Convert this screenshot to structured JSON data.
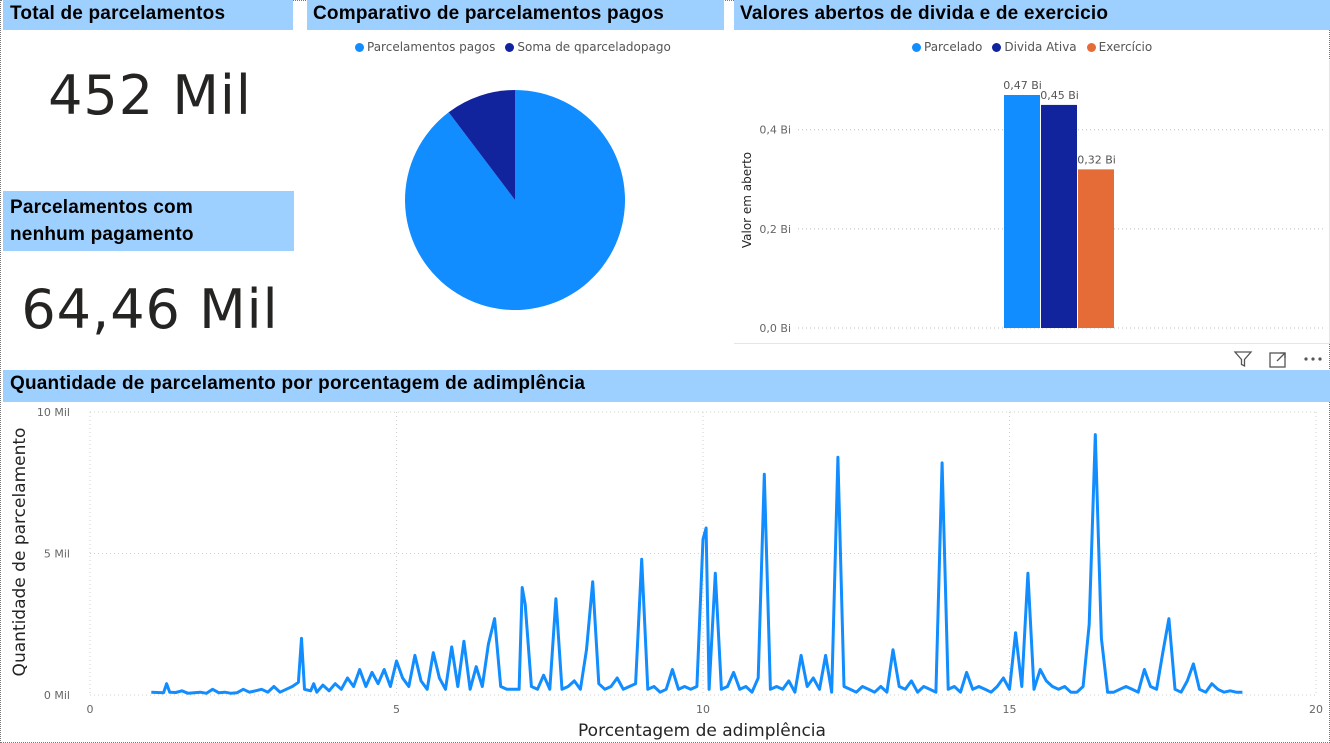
{
  "card_total": {
    "title": "Total de parcelamentos",
    "value": "452 Mil"
  },
  "card_sem_pagamento": {
    "title_line1": "Parcelamentos com",
    "title_line2": "nenhum pagamento",
    "value": "64,46 Mil"
  },
  "pie": {
    "title": "Comparativo de parcelamentos pagos",
    "legend": [
      {
        "label": "Parcelamentos pagos",
        "color": "#118dff"
      },
      {
        "label": "Soma de qparceladopago",
        "color": "#12239e"
      }
    ]
  },
  "bars": {
    "title": "Valores abertos de divida e de exercicio",
    "legend": [
      {
        "label": "Parcelado",
        "color": "#118dff"
      },
      {
        "label": "Divida Ativa",
        "color": "#12239e"
      },
      {
        "label": "Exercício",
        "color": "#e66c37"
      }
    ],
    "ylabel": "Valor em aberto",
    "ticks": [
      "0,0 Bi",
      "0,2 Bi",
      "0,4 Bi"
    ]
  },
  "line": {
    "title": "Quantidade de parcelamento por porcentagem de adimplência",
    "xlabel": "Porcentagem de adimplência",
    "ylabel": "Quantidade de parcelamento",
    "yticks": [
      "0 Mil",
      "5 Mil",
      "10 Mil"
    ],
    "xticks": [
      "0",
      "5",
      "10",
      "15",
      "20"
    ]
  },
  "chart_data": [
    {
      "type": "pie",
      "title": "Comparativo de parcelamentos pagos",
      "categories": [
        "Parcelamentos pagos",
        "Soma de qparceladopago"
      ],
      "values": [
        89.7,
        10.3
      ]
    },
    {
      "type": "bar",
      "title": "Valores abertos de divida e de exercicio",
      "categories": [
        "Parcelado",
        "Divida Ativa",
        "Exercício"
      ],
      "values": [
        0.47,
        0.45,
        0.32
      ],
      "data_labels": [
        "0,47 Bi",
        "0,45 Bi",
        "0,32 Bi"
      ],
      "ylabel": "Valor em aberto",
      "ylim": [
        0,
        0.47
      ],
      "grid": true,
      "legend": "top"
    },
    {
      "type": "line",
      "title": "Quantidade de parcelamento por porcentagem de adimplência",
      "xlabel": "Porcentagem de adimplência",
      "ylabel": "Quantidade de parcelamento",
      "xlim": [
        0,
        20
      ],
      "ylim": [
        0,
        10000
      ],
      "grid": true,
      "x": [
        1.0,
        1.2,
        1.25,
        1.3,
        1.4,
        1.5,
        1.6,
        1.7,
        1.8,
        1.9,
        2.0,
        2.1,
        2.2,
        2.3,
        2.4,
        2.5,
        2.6,
        2.7,
        2.8,
        2.9,
        3.0,
        3.1,
        3.2,
        3.3,
        3.4,
        3.45,
        3.5,
        3.6,
        3.65,
        3.7,
        3.8,
        3.9,
        4.0,
        4.1,
        4.2,
        4.3,
        4.4,
        4.5,
        4.6,
        4.7,
        4.8,
        4.9,
        5.0,
        5.1,
        5.2,
        5.3,
        5.4,
        5.5,
        5.6,
        5.7,
        5.8,
        5.9,
        6.0,
        6.1,
        6.2,
        6.3,
        6.4,
        6.5,
        6.6,
        6.7,
        6.8,
        6.9,
        7.0,
        7.05,
        7.1,
        7.2,
        7.3,
        7.4,
        7.5,
        7.6,
        7.7,
        7.8,
        7.9,
        8.0,
        8.1,
        8.2,
        8.3,
        8.4,
        8.5,
        8.6,
        8.7,
        8.8,
        8.9,
        9.0,
        9.1,
        9.2,
        9.3,
        9.4,
        9.5,
        9.6,
        9.7,
        9.8,
        9.9,
        10.0,
        10.05,
        10.1,
        10.2,
        10.3,
        10.4,
        10.5,
        10.6,
        10.7,
        10.8,
        10.9,
        11.0,
        11.1,
        11.2,
        11.3,
        11.4,
        11.5,
        11.6,
        11.7,
        11.8,
        11.9,
        12.0,
        12.1,
        12.2,
        12.3,
        12.4,
        12.5,
        12.6,
        12.7,
        12.8,
        12.9,
        13.0,
        13.1,
        13.2,
        13.3,
        13.4,
        13.5,
        13.6,
        13.7,
        13.8,
        13.9,
        14.0,
        14.1,
        14.2,
        14.3,
        14.4,
        14.5,
        14.6,
        14.7,
        14.8,
        14.9,
        15.0,
        15.1,
        15.2,
        15.3,
        15.4,
        15.5,
        15.6,
        15.7,
        15.8,
        15.9,
        16.0,
        16.1,
        16.2,
        16.3,
        16.4,
        16.5,
        16.6,
        16.7,
        16.8,
        16.9,
        17.0,
        17.1,
        17.2,
        17.3,
        17.4,
        17.5,
        17.6,
        17.7,
        17.8,
        17.9,
        18.0,
        18.1,
        18.2,
        18.3,
        18.4,
        18.5,
        18.6,
        18.7,
        18.8,
        18.9,
        19.0,
        19.1,
        19.2,
        19.3,
        19.4,
        19.5
      ],
      "y": [
        100,
        80,
        400,
        100,
        90,
        150,
        60,
        80,
        100,
        60,
        200,
        80,
        100,
        60,
        80,
        200,
        100,
        150,
        200,
        100,
        300,
        100,
        200,
        300,
        450,
        2000,
        200,
        150,
        400,
        100,
        350,
        150,
        400,
        200,
        600,
        300,
        900,
        300,
        800,
        400,
        900,
        300,
        1200,
        600,
        300,
        1400,
        500,
        200,
        1500,
        600,
        200,
        1700,
        300,
        1900,
        200,
        1000,
        300,
        1800,
        2700,
        300,
        200,
        200,
        200,
        3800,
        3200,
        300,
        200,
        700,
        200,
        3400,
        200,
        300,
        500,
        200,
        1600,
        4000,
        400,
        200,
        300,
        600,
        200,
        300,
        400,
        4800,
        200,
        300,
        100,
        200,
        900,
        200,
        300,
        200,
        300,
        5500,
        5900,
        200,
        4300,
        200,
        300,
        800,
        200,
        300,
        100,
        600,
        7800,
        200,
        300,
        200,
        500,
        100,
        1400,
        300,
        600,
        200,
        1400,
        100,
        8400,
        300,
        200,
        100,
        300,
        200,
        100,
        300,
        100,
        1600,
        300,
        200,
        500,
        100,
        300,
        200,
        100,
        8200,
        200,
        300,
        100,
        800,
        200,
        300,
        200,
        100,
        300,
        600,
        200,
        2200,
        300,
        4300,
        200,
        900,
        500,
        300,
        200,
        300,
        100,
        100,
        300,
        2500,
        9200,
        2000,
        100,
        100,
        200,
        300,
        200,
        100,
        900,
        300,
        200,
        1500,
        2700,
        200,
        100,
        500,
        1100,
        200,
        100,
        400,
        200,
        100,
        150,
        100,
        100
      ]
    }
  ]
}
